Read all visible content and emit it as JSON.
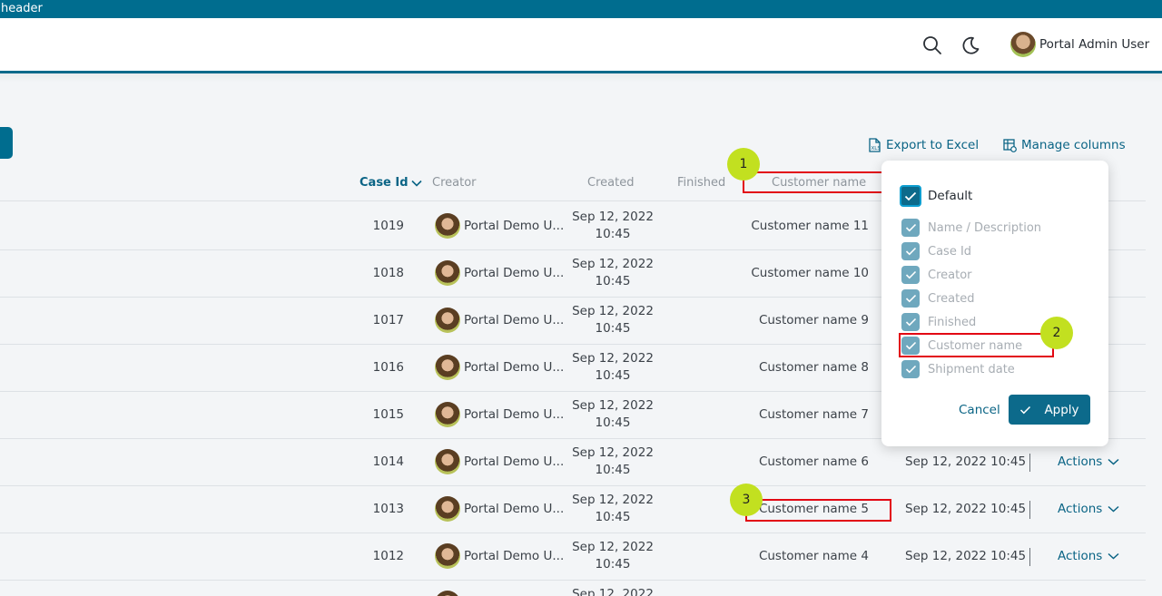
{
  "header": {
    "strip_label": "header",
    "user_name": "Portal Admin User"
  },
  "toolbar": {
    "export_label": "Export to Excel",
    "manage_label": "Manage columns"
  },
  "columns": {
    "case_id": "Case Id",
    "creator": "Creator",
    "created": "Created",
    "finished": "Finished",
    "customer_name": "Customer name"
  },
  "rows": [
    {
      "id": "1019",
      "creator": "Portal Demo U...",
      "date": "Sep 12, 2022",
      "time": "10:45",
      "customer": "Customer name 11",
      "shipment": "",
      "actions": ""
    },
    {
      "id": "1018",
      "creator": "Portal Demo U...",
      "date": "Sep 12, 2022",
      "time": "10:45",
      "customer": "Customer name 10",
      "shipment": "",
      "actions": ""
    },
    {
      "id": "1017",
      "creator": "Portal Demo U...",
      "date": "Sep 12, 2022",
      "time": "10:45",
      "customer": "Customer name 9",
      "shipment": "",
      "actions": ""
    },
    {
      "id": "1016",
      "creator": "Portal Demo U...",
      "date": "Sep 12, 2022",
      "time": "10:45",
      "customer": "Customer name 8",
      "shipment": "",
      "actions": ""
    },
    {
      "id": "1015",
      "creator": "Portal Demo U...",
      "date": "Sep 12, 2022",
      "time": "10:45",
      "customer": "Customer name 7",
      "shipment": "",
      "actions": ""
    },
    {
      "id": "1014",
      "creator": "Portal Demo U...",
      "date": "Sep 12, 2022",
      "time": "10:45",
      "customer": "Customer name 6",
      "shipment": "Sep 12, 2022 10:45",
      "actions": "Actions"
    },
    {
      "id": "1013",
      "creator": "Portal Demo U...",
      "date": "Sep 12, 2022",
      "time": "10:45",
      "customer": "Customer name 5",
      "shipment": "Sep 12, 2022 10:45",
      "actions": "Actions"
    },
    {
      "id": "1012",
      "creator": "Portal Demo U...",
      "date": "Sep 12, 2022",
      "time": "10:45",
      "customer": "Customer name 4",
      "shipment": "Sep 12, 2022 10:45",
      "actions": "Actions"
    },
    {
      "id": "",
      "creator": "",
      "date": "Sep 12, 2022",
      "time": "",
      "customer": "",
      "shipment": "",
      "actions": ""
    }
  ],
  "badges": [
    "1",
    "2",
    "3"
  ],
  "popup": {
    "default_label": "Default",
    "options": [
      "Name / Description",
      "Case Id",
      "Creator",
      "Created",
      "Finished",
      "Customer name",
      "Shipment date"
    ],
    "cancel_label": "Cancel",
    "apply_label": "Apply"
  },
  "colors": {
    "brand": "#006d8f",
    "accent": "#0c6a8b",
    "highlight": "#e20613",
    "badge": "#c2e020"
  }
}
